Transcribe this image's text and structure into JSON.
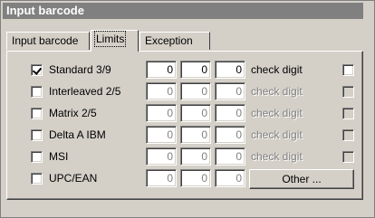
{
  "window": {
    "title": "Input barcode"
  },
  "tabs": [
    {
      "label": "Input barcode",
      "active": false
    },
    {
      "label": "Limits",
      "active": true
    },
    {
      "label": "Exception",
      "active": false
    }
  ],
  "rows": [
    {
      "label": "Standard 3/9",
      "checked": true,
      "enabled": true,
      "values": [
        "0",
        "0",
        "0"
      ],
      "check_digit_label": "check digit"
    },
    {
      "label": "Interleaved 2/5",
      "checked": false,
      "enabled": false,
      "values": [
        "0",
        "0",
        "0"
      ],
      "check_digit_label": "check digit"
    },
    {
      "label": "Matrix 2/5",
      "checked": false,
      "enabled": false,
      "values": [
        "0",
        "0",
        "0"
      ],
      "check_digit_label": "check digit"
    },
    {
      "label": "Delta A IBM",
      "checked": false,
      "enabled": false,
      "values": [
        "0",
        "0",
        "0"
      ],
      "check_digit_label": "check digit"
    },
    {
      "label": "MSI",
      "checked": false,
      "enabled": false,
      "values": [
        "0",
        "0",
        "0"
      ],
      "check_digit_label": "check digit"
    },
    {
      "label": "UPC/EAN",
      "checked": false,
      "enabled": false,
      "values": [
        "0",
        "0",
        "0"
      ],
      "other_button_label": "Other ..."
    }
  ]
}
